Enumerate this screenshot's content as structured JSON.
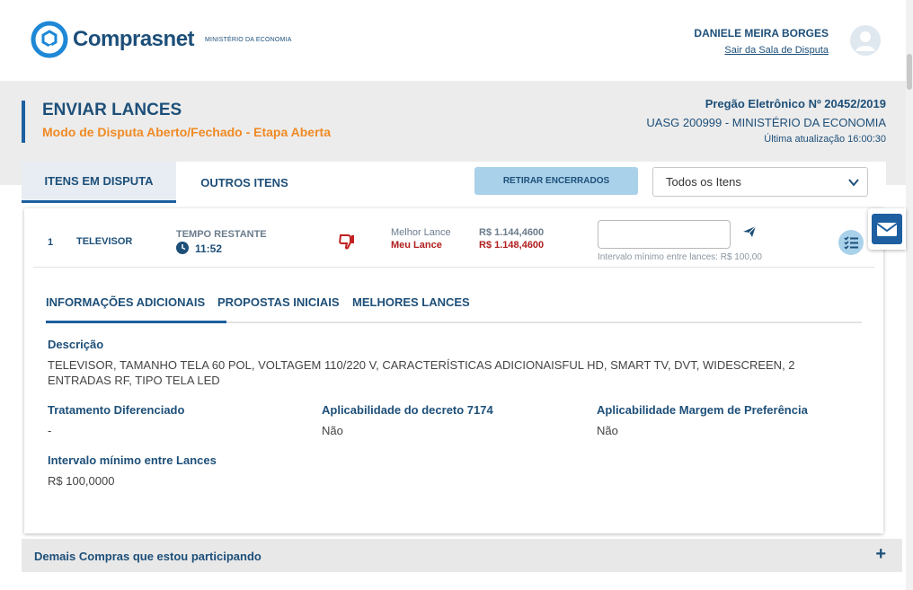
{
  "header": {
    "logo_text": "Comprasnet",
    "logo_sub": "MINISTÉRIO DA ECONOMIA",
    "user_name": "DANIELE MEIRA BORGES",
    "logout_label": "Sair da Sala de Disputa"
  },
  "page": {
    "title": "ENVIAR LANCES",
    "subtitle": "Modo de Disputa Aberto/Fechado - Etapa Aberta",
    "pregao": "Pregão Eletrônico Nº 20452/2019",
    "uasg": "UASG 200999 - MINISTÉRIO DA ECONOMIA",
    "updated": "Última atualização 16:00:30"
  },
  "tabs": {
    "active": "ITENS EM DISPUTA",
    "other": "OUTROS ITENS",
    "retirar_button": "RETIRAR ENCERRADOS",
    "filter_value": "Todos os Itens"
  },
  "item": {
    "number": "1",
    "name": "TELEVISOR",
    "time_label": "TEMPO RESTANTE",
    "time_value": "11:52",
    "best_label": "Melhor Lance",
    "mine_label": "Meu Lance",
    "best_value": "R$ 1.144,4600",
    "mine_value": "R$ 1.148,4600",
    "bid_value": "",
    "hint": "Intervalo mínimo entre lances: R$ 100,00"
  },
  "subtabs": [
    "INFORMAÇÕES ADICIONAIS",
    "PROPOSTAS INICIAIS",
    "MELHORES LANCES"
  ],
  "details": {
    "descricao_label": "Descrição",
    "descricao_value": "TELEVISOR, TAMANHO TELA 60 POL, VOLTAGEM 110/220 V, CARACTERÍSTICAS ADICIONAISFUL HD, SMART TV, DVT, WIDESCREEN, 2 ENTRADAS RF, TIPO TELA LED",
    "tratamento_label": "Tratamento Diferenciado",
    "tratamento_value": "-",
    "decreto_label": "Aplicabilidade do decreto 7174",
    "decreto_value": "Não",
    "margem_label": "Aplicabilidade Margem de Preferência",
    "margem_value": "Não",
    "intervalo_label": "Intervalo mínimo entre Lances",
    "intervalo_value": "R$ 100,0000"
  },
  "footer": {
    "label": "Demais Compras que estou participando",
    "toggle": "+"
  },
  "colors": {
    "brand": "#1d4f79",
    "accent_orange": "#f08a24",
    "alert_red": "#b01e1e",
    "button_light_blue": "#a9d1ea"
  },
  "icons": [
    "logo-icon",
    "user-avatar-icon",
    "clock-icon",
    "thumbs-down-icon",
    "send-icon",
    "checklist-icon",
    "chevron-down-icon",
    "mail-icon",
    "plus-icon"
  ]
}
